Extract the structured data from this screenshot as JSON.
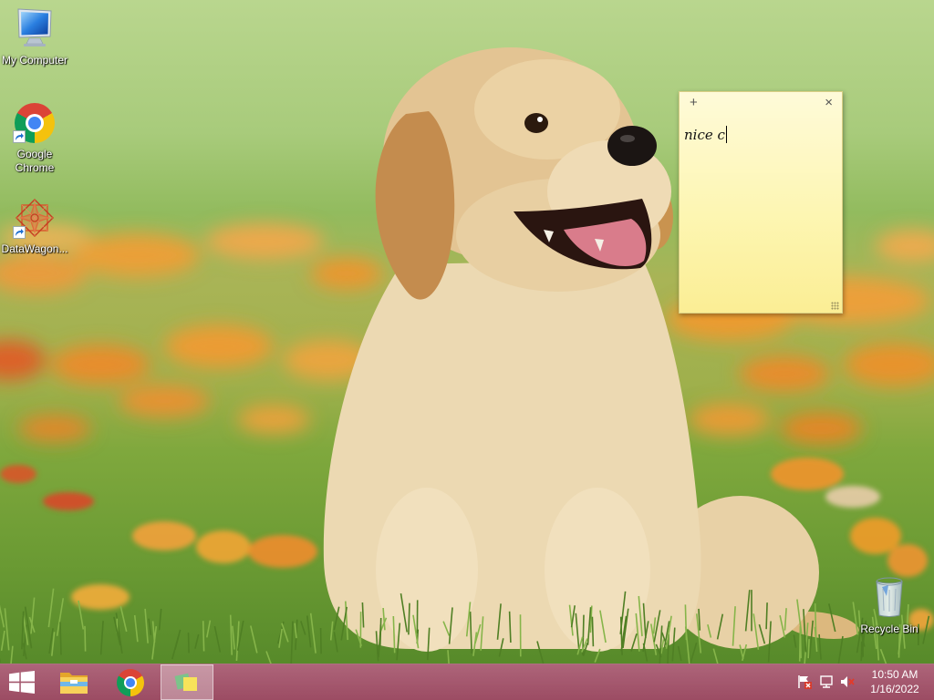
{
  "desktop": {
    "icons": [
      {
        "label": "My Computer",
        "icon": "computer-icon",
        "shortcut": false
      },
      {
        "label": "Google Chrome",
        "icon": "chrome-icon",
        "shortcut": true
      },
      {
        "label": "DataWagon...",
        "icon": "datawagon-icon",
        "shortcut": true
      }
    ],
    "recycle_bin": {
      "label": "Recycle Bin",
      "icon": "recycle-bin-icon"
    }
  },
  "sticky_note": {
    "new_note_glyph": "+",
    "close_glyph": "×",
    "text": "nice c",
    "color": "#fdf5aa"
  },
  "taskbar": {
    "color": "#a24f67",
    "start_icon": "windows-logo-icon",
    "pinned": [
      {
        "icon": "file-explorer-icon",
        "active": false
      },
      {
        "icon": "chrome-icon",
        "active": false
      },
      {
        "icon": "sticky-notes-icon",
        "active": true
      }
    ],
    "tray_icons": [
      "action-center-flag-icon",
      "network-icon",
      "volume-muted-icon"
    ],
    "clock": {
      "time": "10:50 AM",
      "date": "1/16/2022"
    }
  }
}
